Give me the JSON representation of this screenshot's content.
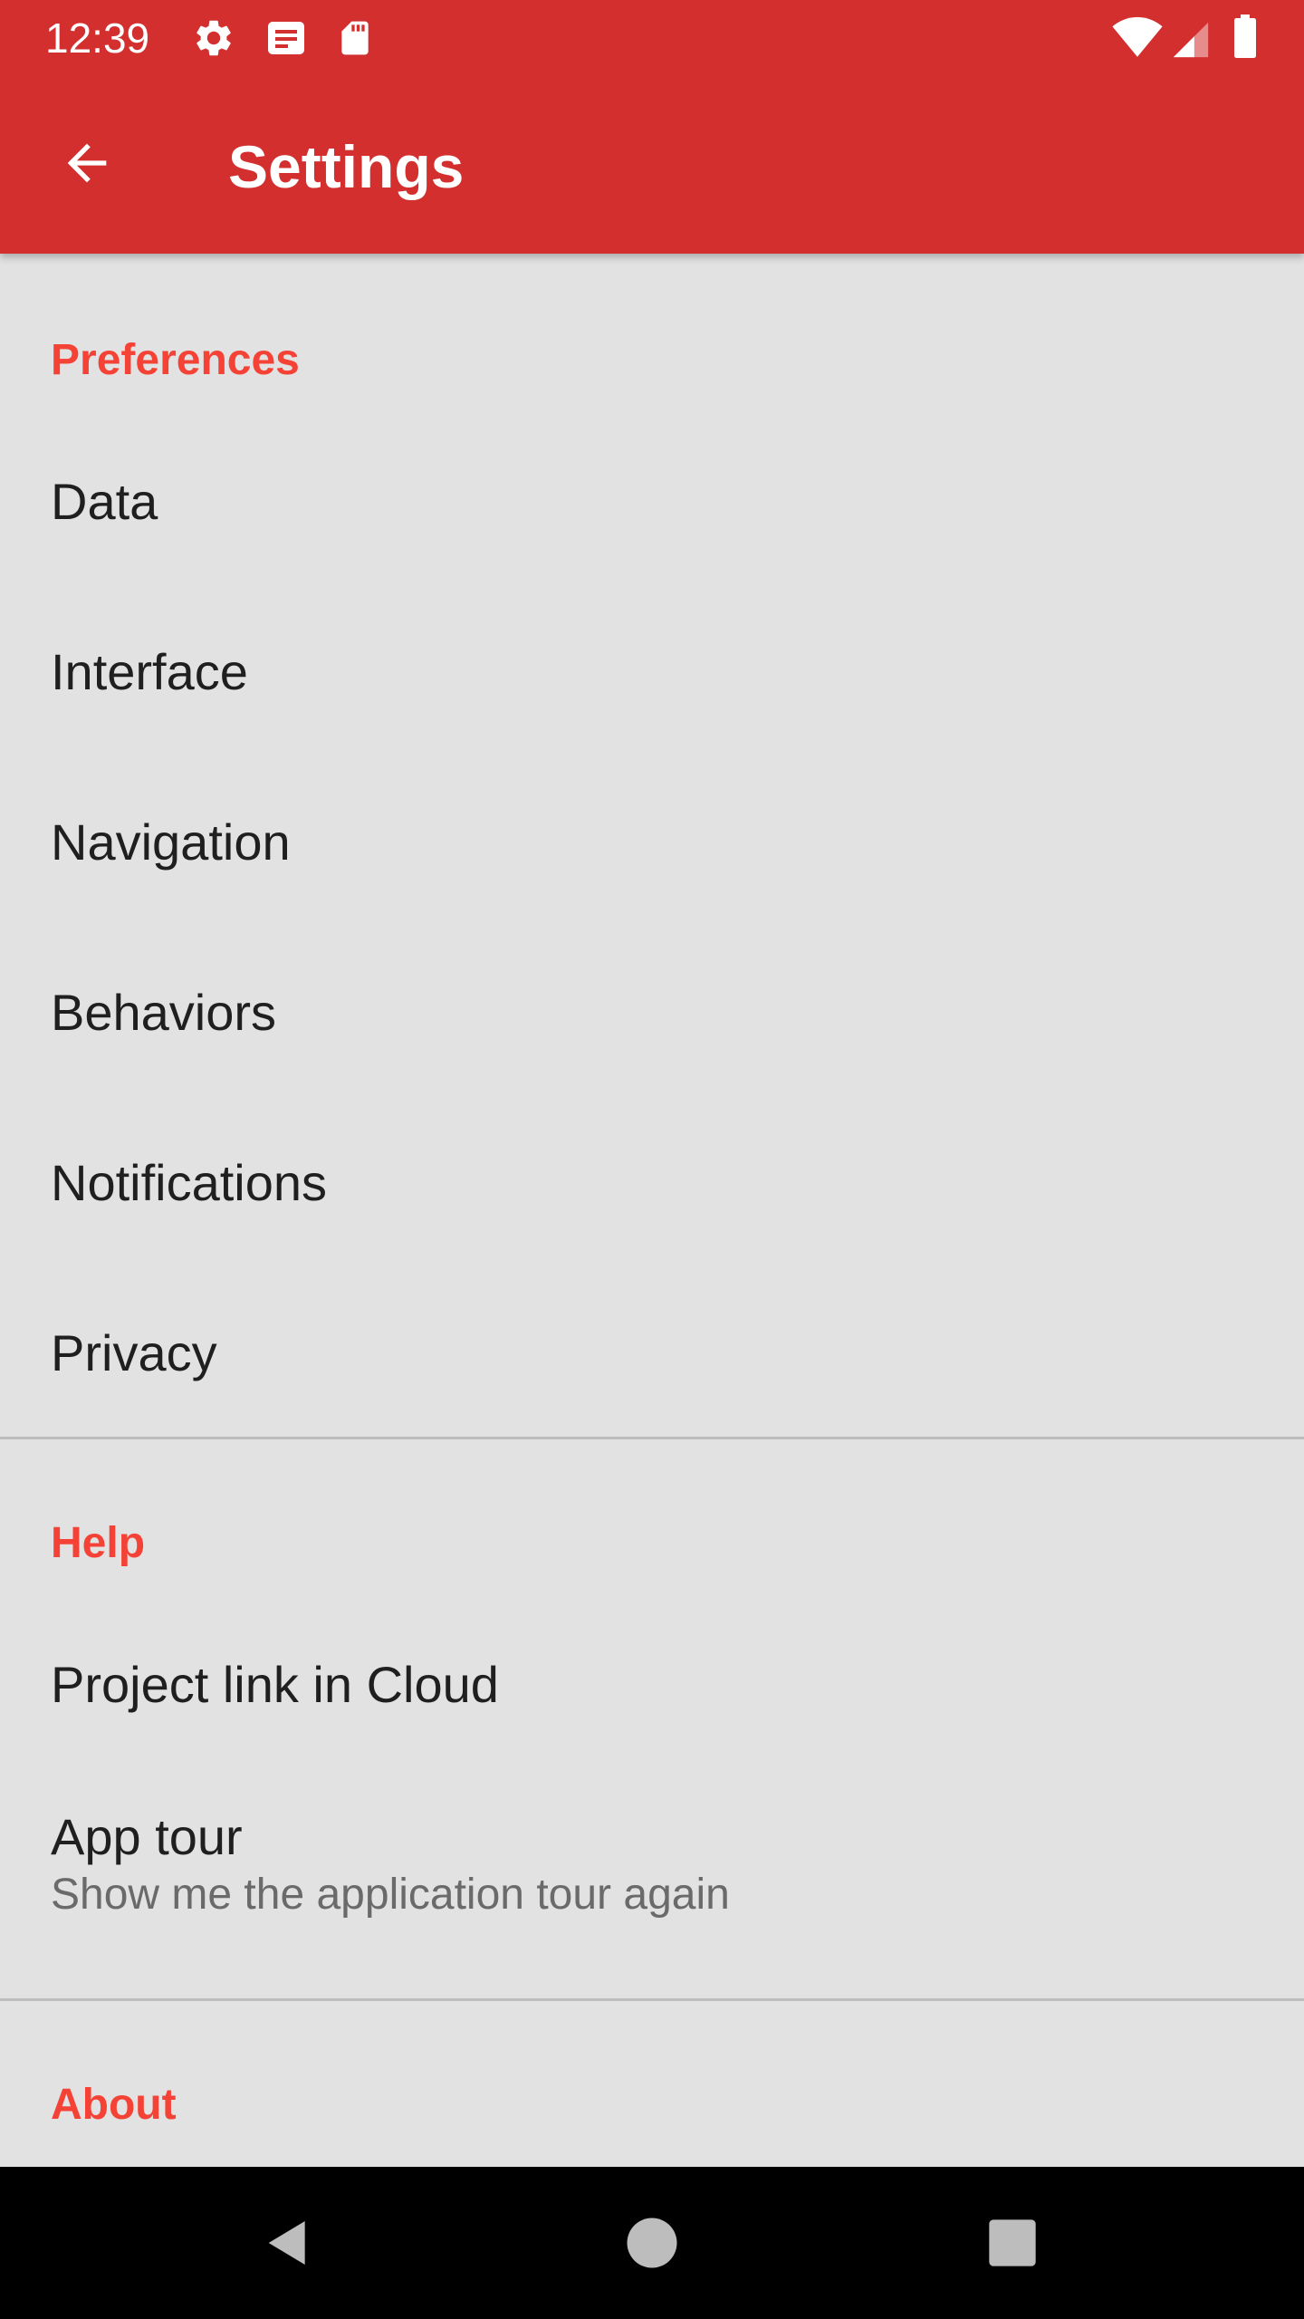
{
  "status_bar": {
    "time": "12:39",
    "left_icons": [
      "gear-icon",
      "notification-icon",
      "sd-card-icon"
    ],
    "right_icons": [
      "wifi-icon",
      "cellular-signal-icon",
      "battery-icon"
    ]
  },
  "app_bar": {
    "title": "Settings",
    "back_icon": "arrow-back-icon",
    "background_color": "#d32f2f"
  },
  "sections": [
    {
      "header": "Preferences",
      "items": [
        {
          "title": "Data"
        },
        {
          "title": "Interface"
        },
        {
          "title": "Navigation"
        },
        {
          "title": "Behaviors"
        },
        {
          "title": "Notifications"
        },
        {
          "title": "Privacy"
        }
      ]
    },
    {
      "header": "Help",
      "items": [
        {
          "title": "Project link in Cloud"
        },
        {
          "title": "App tour",
          "summary": "Show me the application tour again"
        }
      ]
    },
    {
      "header": "About",
      "items": []
    }
  ],
  "colors": {
    "accent": "#f44336",
    "content_background": "#e2e2e2",
    "text_primary": "#1f1f1f",
    "text_secondary": "#6a6a6a"
  },
  "nav_bar": {
    "buttons": [
      "back-triangle-icon",
      "home-circle-icon",
      "recents-square-icon"
    ]
  }
}
